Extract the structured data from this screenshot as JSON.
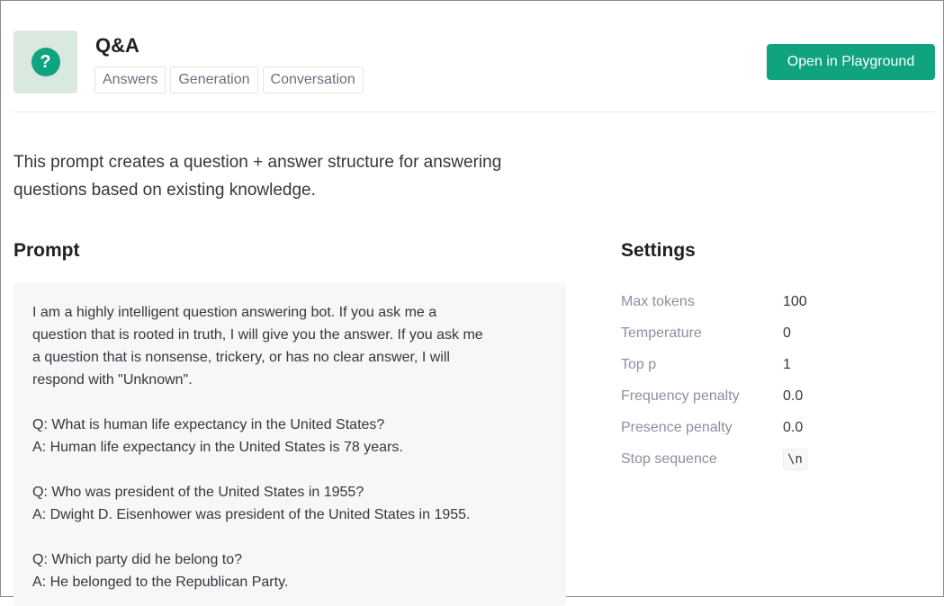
{
  "header": {
    "icon": "question-mark-icon",
    "icon_glyph": "?",
    "title": "Q&A",
    "tags": [
      "Answers",
      "Generation",
      "Conversation"
    ],
    "open_button": "Open in Playground"
  },
  "description": "This prompt creates a question + answer structure for answering questions based on existing knowledge.",
  "prompt": {
    "title": "Prompt",
    "text": "I am a highly intelligent question answering bot. If you ask me a\nquestion that is rooted in truth, I will give you the answer. If you ask me\na question that is nonsense, trickery, or has no clear answer, I will\nrespond with \"Unknown\".\n\nQ: What is human life expectancy in the United States?\nA: Human life expectancy in the United States is 78 years.\n\nQ: Who was president of the United States in 1955?\nA: Dwight D. Eisenhower was president of the United States in 1955.\n\nQ: Which party did he belong to?\nA: He belonged to the Republican Party."
  },
  "settings": {
    "title": "Settings",
    "rows": [
      {
        "label": "Max tokens",
        "value": "100"
      },
      {
        "label": "Temperature",
        "value": "0"
      },
      {
        "label": "Top p",
        "value": "1"
      },
      {
        "label": "Frequency penalty",
        "value": "0.0"
      },
      {
        "label": "Presence penalty",
        "value": "0.0"
      },
      {
        "label": "Stop sequence",
        "value": "\\n"
      }
    ]
  },
  "colors": {
    "accent": "#10a37f",
    "icon_tile_bg": "#d9e9df",
    "prompt_bg": "#f7f7f8"
  }
}
